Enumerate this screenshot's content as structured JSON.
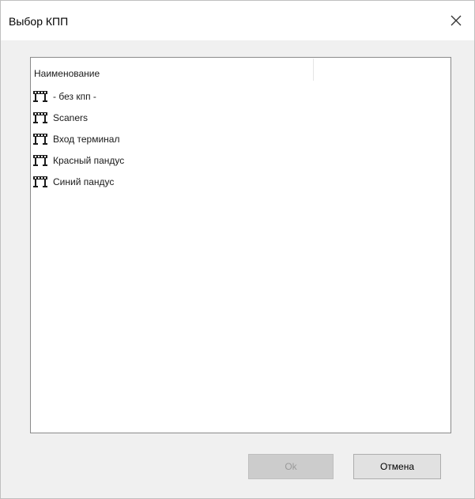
{
  "window": {
    "title": "Выбор КПП",
    "close_symbol": "close-icon"
  },
  "list": {
    "column_header": "Наименование",
    "items": [
      {
        "label": "- без кпп -",
        "icon": "barrier-gate-icon"
      },
      {
        "label": "Scaners",
        "icon": "barrier-gate-icon"
      },
      {
        "label": "Вход терминал",
        "icon": "barrier-gate-icon"
      },
      {
        "label": "Красный пандус",
        "icon": "barrier-gate-icon"
      },
      {
        "label": "Синий пандус",
        "icon": "barrier-gate-icon"
      }
    ]
  },
  "buttons": {
    "ok_label": "Ok",
    "cancel_label": "Отмена"
  },
  "colors": {
    "window_bg": "#f0f0f0",
    "list_bg": "#ffffff",
    "disabled_button_bg": "#cccccc",
    "disabled_text": "#9a9a9a",
    "icon_color": "#1a1a1a"
  }
}
